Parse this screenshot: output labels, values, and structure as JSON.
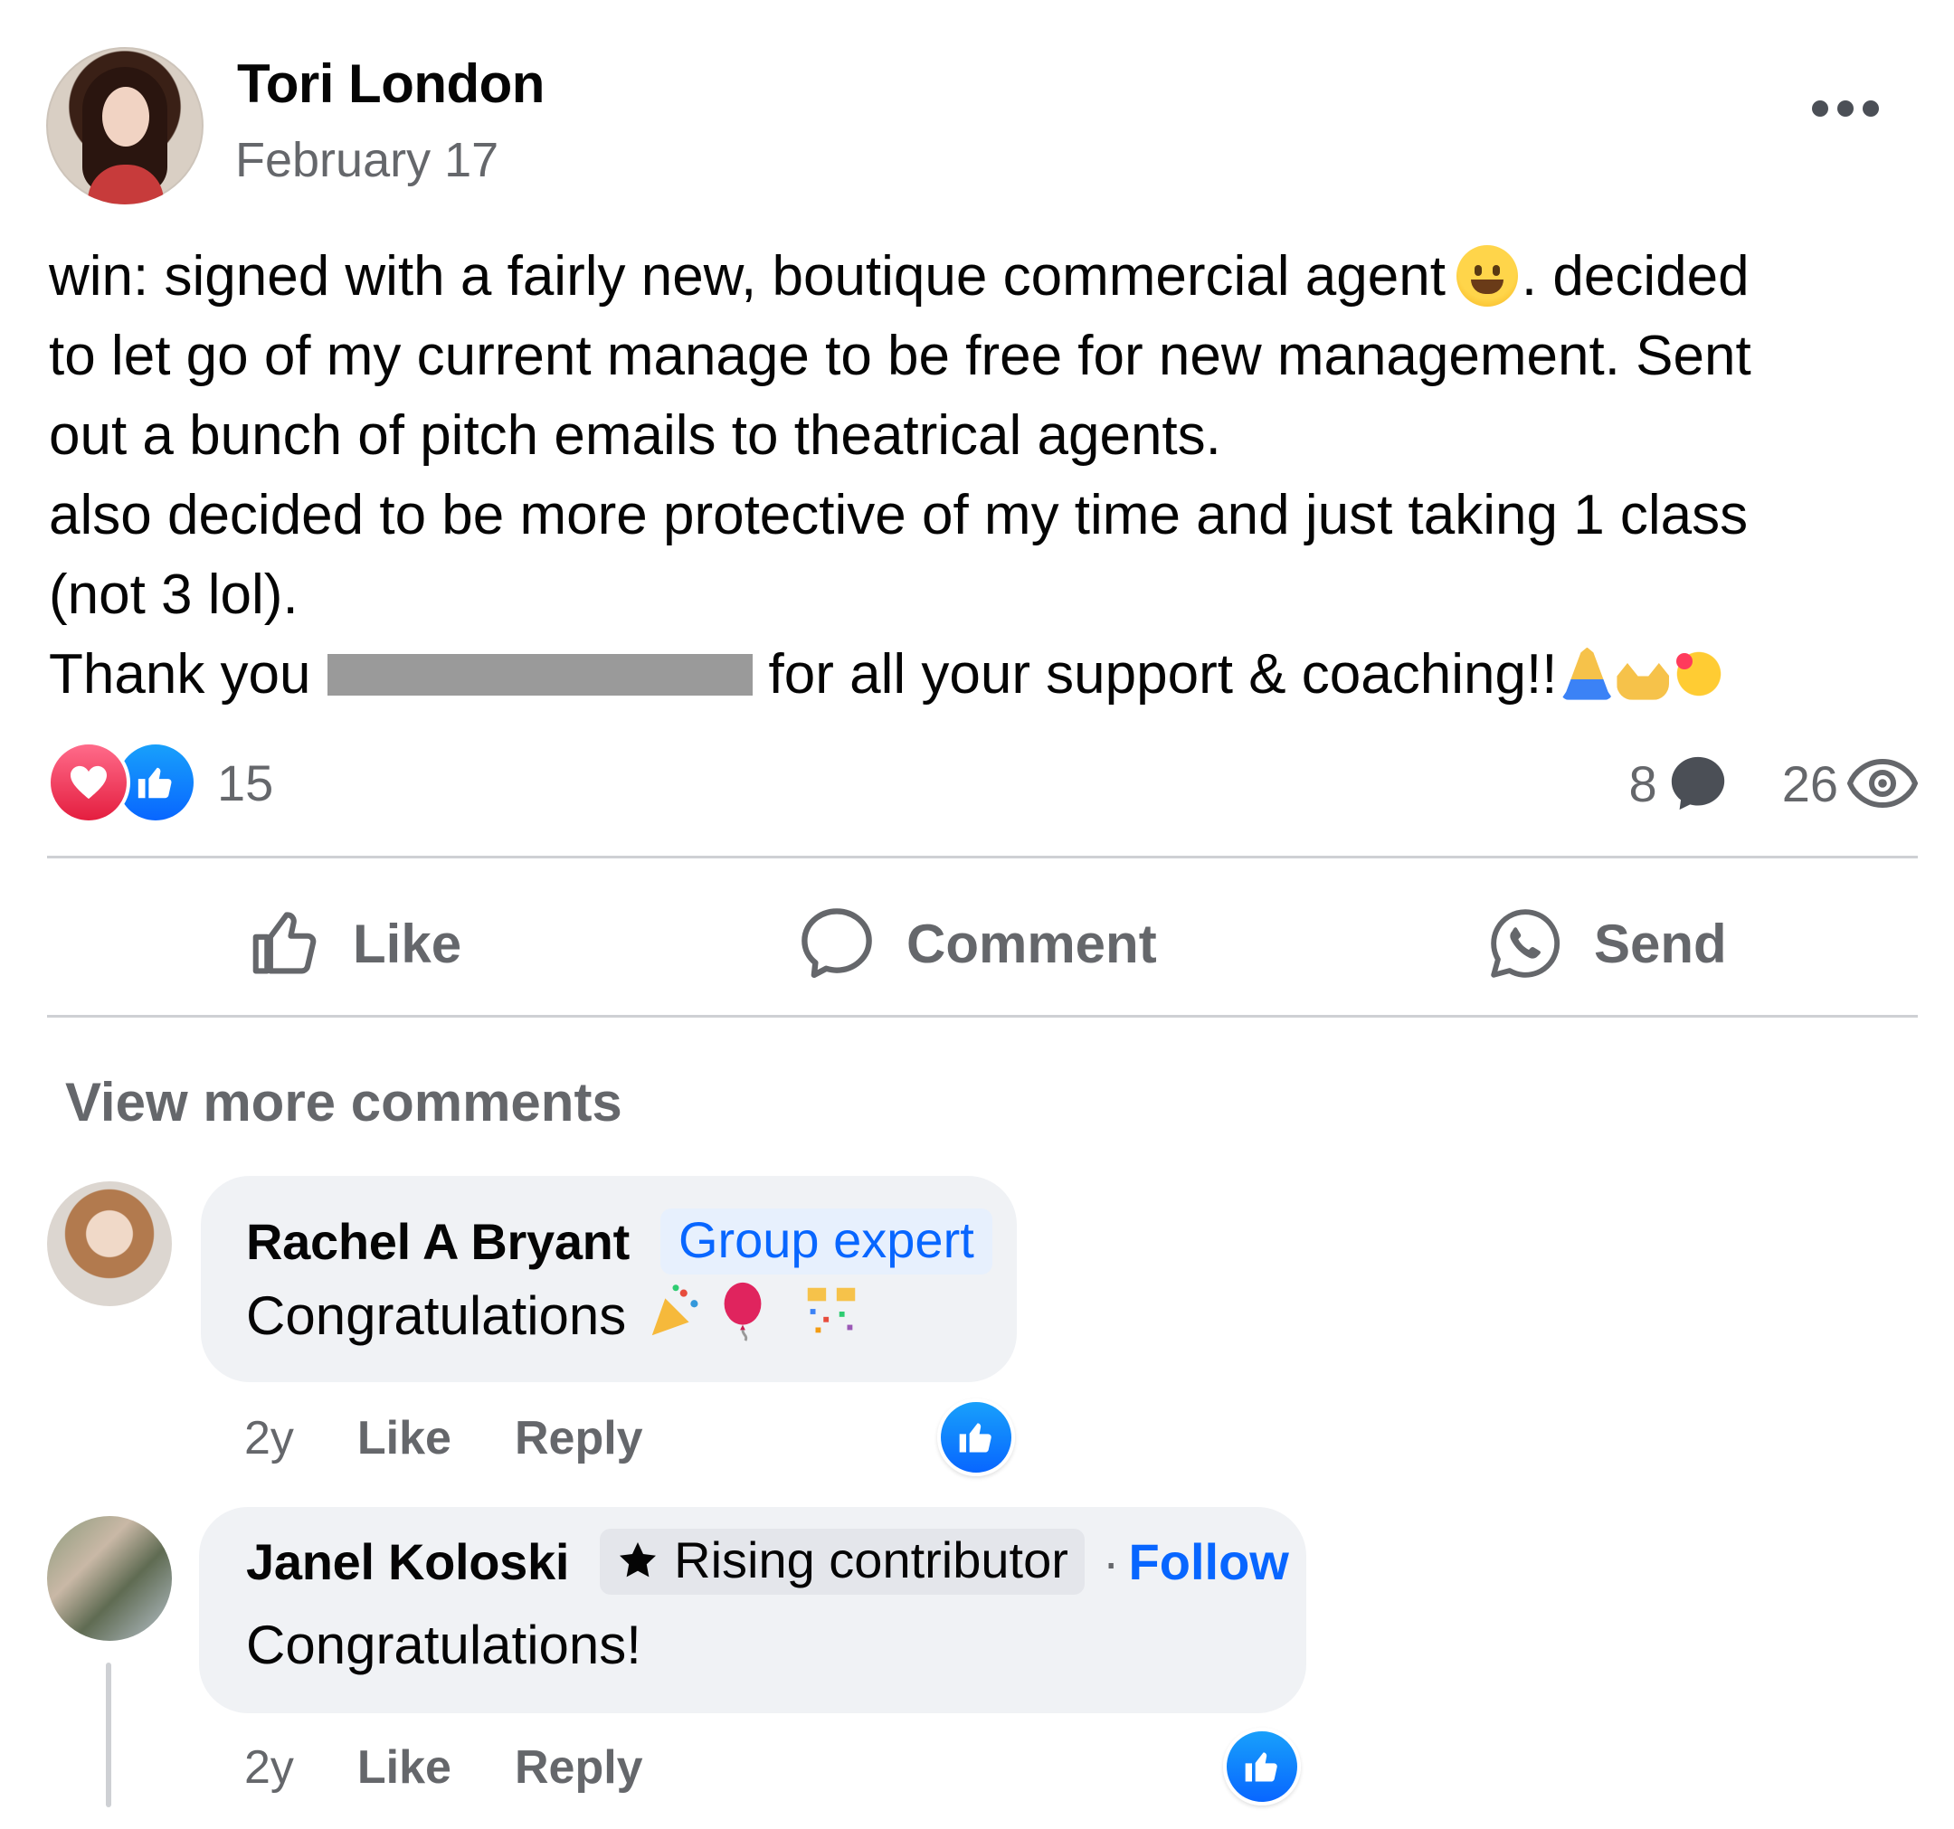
{
  "post": {
    "author": "Tori London",
    "date": "February 17",
    "lines": {
      "l1a": "win:  signed with a fairly new, boutique commercial agent",
      "l1b": ".  decided",
      "l2": "to let go of my current manage to be free for new management.  Sent",
      "l3": "out a bunch of pitch emails to theatrical agents.",
      "l4": "also decided to be more protective of my time and just taking 1 class",
      "l5": "(not 3 lol).",
      "l6a": "Thank you",
      "l6b": "for all your support & coaching!!"
    },
    "reaction_count": "15",
    "comment_count": "8",
    "view_count": "26"
  },
  "actions": {
    "like": "Like",
    "comment": "Comment",
    "send": "Send"
  },
  "comments_section": {
    "view_more": "View more comments",
    "comments": [
      {
        "author": "Rachel A Bryant",
        "badge": "Group expert",
        "text": "Congratulations",
        "time": "2y",
        "like": "Like",
        "reply": "Reply"
      },
      {
        "author": "Janel Koloski",
        "badge": "Rising contributor",
        "follow": "Follow",
        "text": "Congratulations!",
        "time": "2y",
        "like": "Like",
        "reply": "Reply"
      }
    ]
  },
  "colors": {
    "primary_blue": "#0866ff",
    "secondary_text": "#65676b",
    "bubble_bg": "#f0f2f5",
    "love_red": "#e41e3f"
  },
  "icons": [
    "more-icon",
    "love-reaction-icon",
    "like-reaction-icon",
    "comment-count-icon",
    "eye-icon",
    "like-icon",
    "comment-icon",
    "whatsapp-send-icon",
    "star-icon"
  ]
}
